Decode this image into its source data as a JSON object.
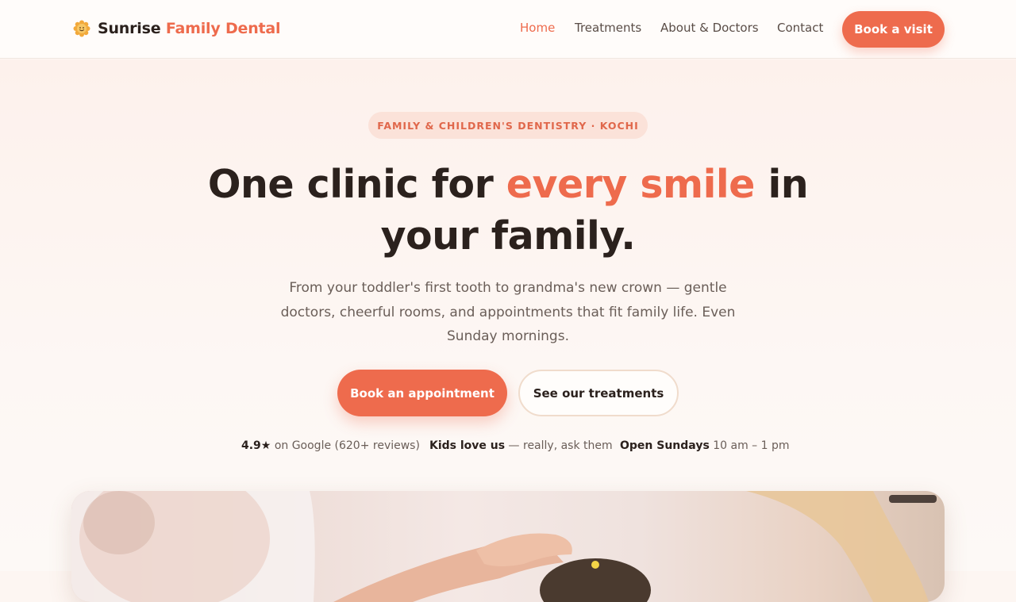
{
  "header": {
    "brand_icon": "sun-flower-icon",
    "brand_part1": "Sunrise",
    "brand_part2": "Family Dental",
    "nav": [
      {
        "label": "Home",
        "active": true
      },
      {
        "label": "Treatments",
        "active": false
      },
      {
        "label": "About & Doctors",
        "active": false
      },
      {
        "label": "Contact",
        "active": false
      }
    ],
    "cta_label": "Book a visit"
  },
  "hero": {
    "eyebrow": "FAMILY & CHILDREN'S DENTISTRY · KOCHI",
    "title_before": "One clinic for",
    "title_accent": "every smile",
    "title_after": "in your family.",
    "subtitle": "From your toddler's first tooth to grandma's new crown — gentle doctors, cheerful rooms, and appointments that fit family life. Even Sunday mornings.",
    "primary_button": "Book an appointment",
    "secondary_button": "See our treatments",
    "trust": [
      {
        "strong": "4.9★",
        "rest": "on Google (620+ reviews)"
      },
      {
        "strong": "Kids love us",
        "rest": "— really, ask them"
      },
      {
        "strong": "Open Sundays",
        "rest": "10 am – 1 pm"
      }
    ],
    "image": "child-at-dentist-photo"
  },
  "colors": {
    "accent": "#ee6b4d",
    "text_dark": "#2b211d",
    "text_muted": "#6a5e58",
    "background": "#fdf6f2",
    "pill_bg": "#fbe2d9"
  }
}
